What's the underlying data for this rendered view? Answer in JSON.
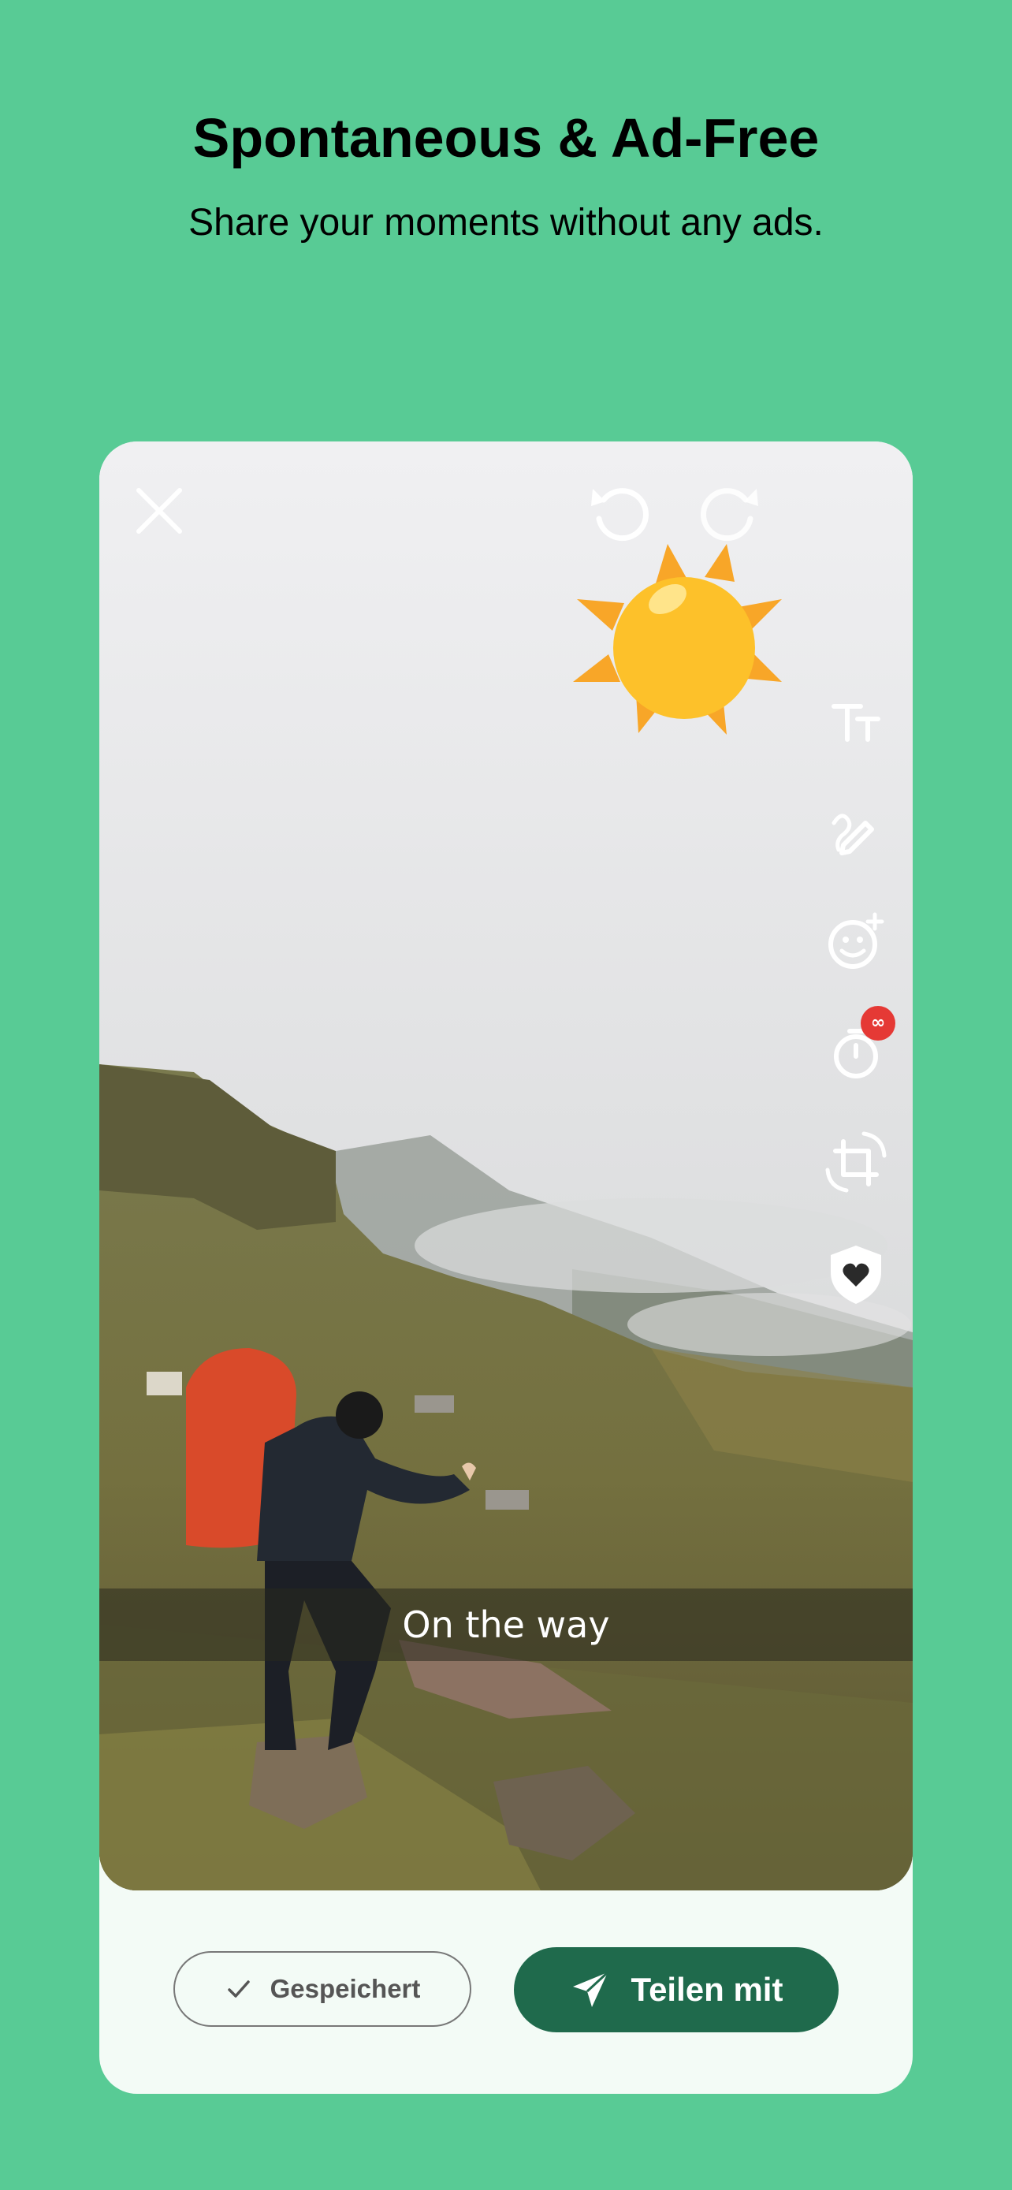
{
  "headline": "Spontaneous & Ad-Free",
  "subline": "Share your moments without any ads.",
  "editor": {
    "caption": "On the way",
    "timer_badge": "∞",
    "toolbar_icons": [
      "text-size-icon",
      "draw-icon",
      "sticker-add-icon",
      "timer-icon",
      "crop-rotate-icon",
      "privacy-shield-icon"
    ],
    "top_icons": [
      "close-icon",
      "undo-icon",
      "redo-icon"
    ],
    "sticker": "sun-sticker"
  },
  "actions": {
    "saved_label": "Gespeichert",
    "share_label": "Teilen mit"
  },
  "colors": {
    "background": "#58CB95",
    "share_button": "#1F6A4C",
    "card": "#F3FBF6",
    "badge": "#E53935",
    "sun": "#FDC12A",
    "sun_rays": "#F8A628"
  }
}
